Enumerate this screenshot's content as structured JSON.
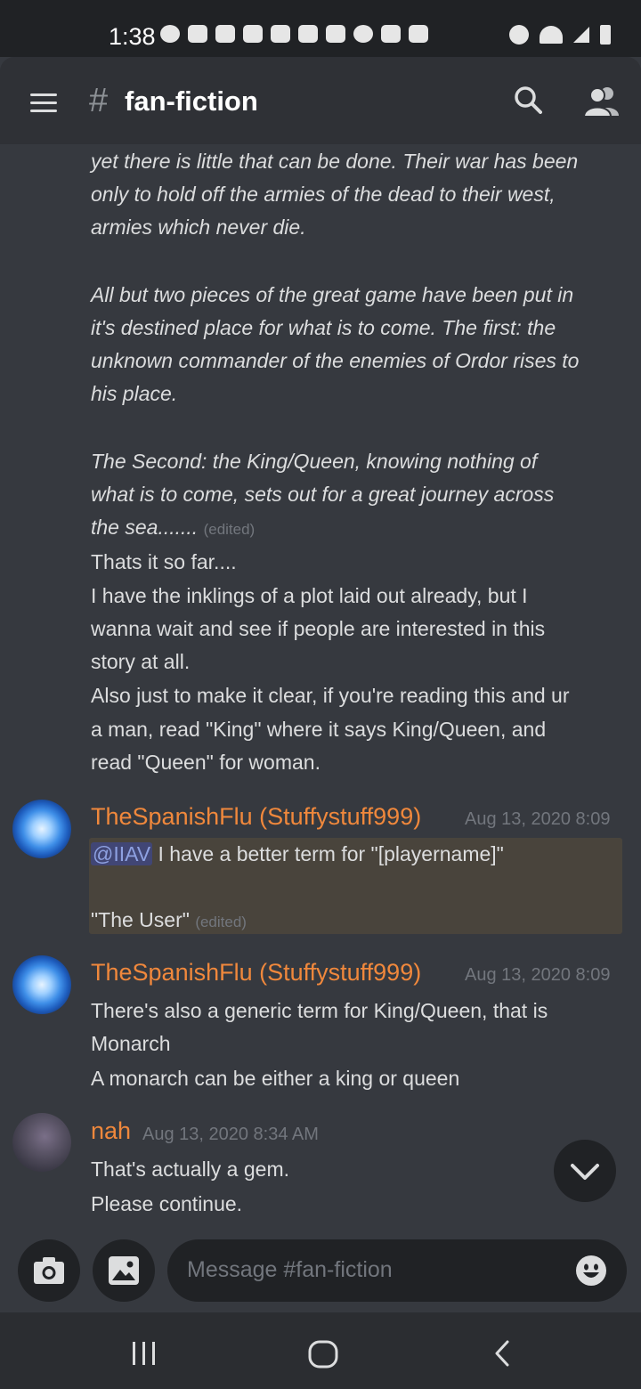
{
  "status_bar": {
    "time": "1:38"
  },
  "header": {
    "hash": "#",
    "channel_name": "fan-fiction"
  },
  "story_lines": [
    "yet there is little that can be done. Their war has been",
    "only to hold off the armies of the dead to their west,",
    "armies which never die.",
    "All but two pieces of the great game have been put in",
    "it's destined place for what is to come. The first: the",
    "unknown commander of the enemies of Ordor rises to",
    "his place.",
    "The Second: the King/Queen, knowing nothing of",
    "what is to come, sets out for a great journey across",
    "the sea......."
  ],
  "edited_label": "(edited)",
  "plain_lines": [
    "Thats it so far....",
    "I have the inklings of a plot laid out already, but I",
    "wanna wait and see if people are interested in this",
    "story at all.",
    "Also just to make it clear, if you're reading this and ur",
    "a man, read \"King\" where it says King/Queen, and",
    "read \"Queen\" for woman."
  ],
  "messages": [
    {
      "author": "TheSpanishFlu (Stuffystuff999)",
      "time": "Aug 13, 2020 8:09",
      "mention": "@IIAV",
      "line1": " I have a better term for \"[playername]\"",
      "line2": "\"The User\""
    },
    {
      "author": "TheSpanishFlu (Stuffystuff999)",
      "time": "Aug 13, 2020 8:09",
      "lines": [
        "There's also a generic term for King/Queen, that is",
        "Monarch",
        "A monarch can be either a king or queen"
      ]
    },
    {
      "author": "nah",
      "time": "Aug 13, 2020 8:34 AM",
      "lines": [
        "That's actually a gem.",
        "Please continue."
      ]
    }
  ],
  "input": {
    "placeholder": "Message #fan-fiction"
  },
  "colors": {
    "accent_username": "#f0883c",
    "background": "#36393f",
    "header": "#2f3136"
  },
  "icons": [
    "hamburger-icon",
    "search-icon",
    "members-icon",
    "camera-icon",
    "image-icon",
    "emoji-icon",
    "chevron-down-icon",
    "recents-icon",
    "home-icon",
    "back-icon"
  ]
}
